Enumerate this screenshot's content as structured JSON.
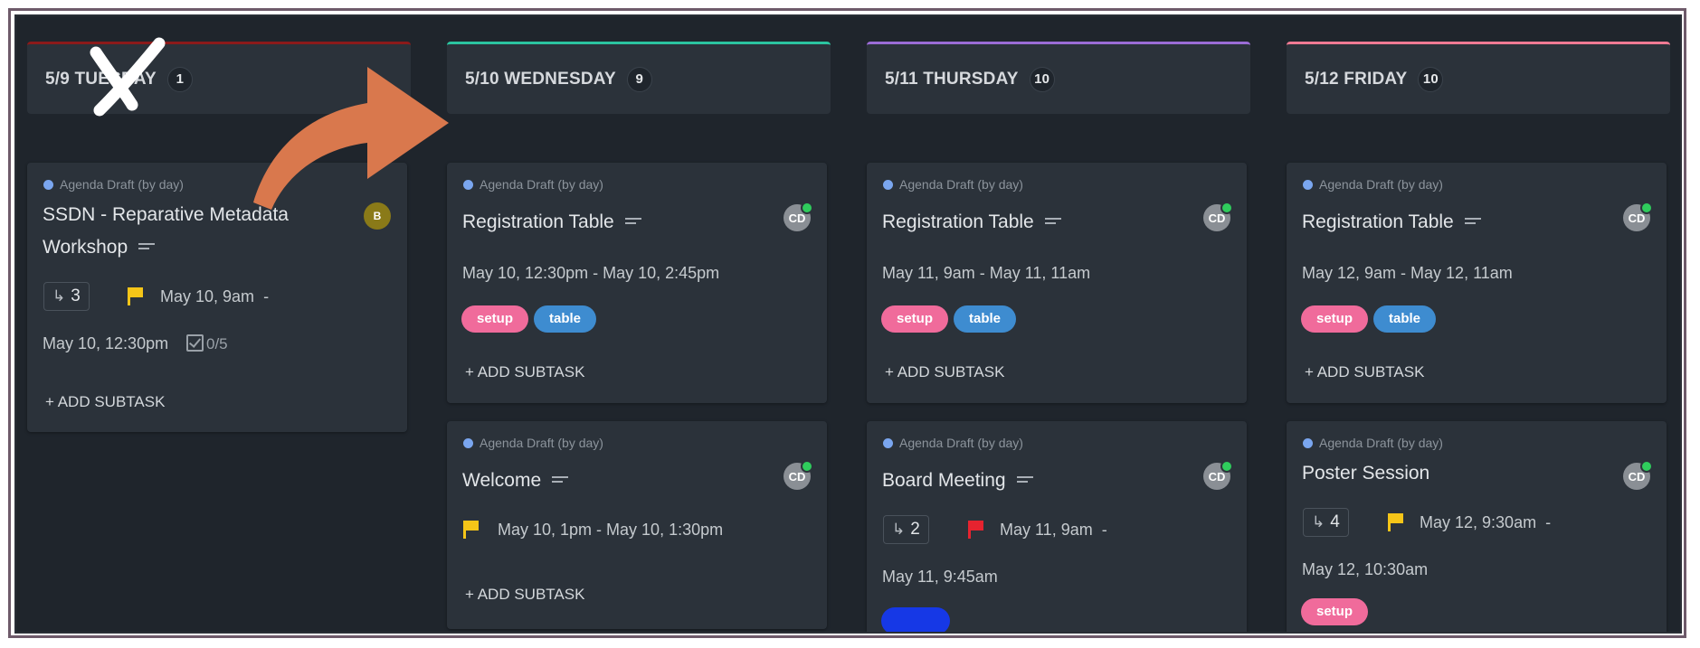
{
  "columns": [
    {
      "title": "5/9 TUESDAY",
      "count": "1",
      "accent": "#8b1a1a"
    },
    {
      "title": "5/10 WEDNESDAY",
      "count": "9",
      "accent": "#2bc4a0"
    },
    {
      "title": "5/11 THURSDAY",
      "count": "10",
      "accent": "#9b6cd6"
    },
    {
      "title": "5/12 FRIDAY",
      "count": "10",
      "accent": "#f07a93"
    }
  ],
  "list_label": "Agenda Draft (by day)",
  "add_subtask": "+ ADD SUBTASK",
  "cards": {
    "tue_1": {
      "title_l1": "SSDN - Reparative Metadata",
      "title_l2": "Workshop",
      "avatar": "B",
      "subtasks": "3",
      "start": "May 10, 9am",
      "dash": "-",
      "end": "May 10, 12:30pm",
      "checklist": "0/5"
    },
    "wed_1": {
      "title": "Registration Table",
      "avatar": "CD",
      "dates": "May 10, 12:30pm  -  May 10, 2:45pm",
      "tags": [
        "setup",
        "table"
      ]
    },
    "wed_2": {
      "title": "Welcome",
      "avatar": "CD",
      "dates": "May 10, 1pm  -  May 10, 1:30pm"
    },
    "thu_1": {
      "title": "Registration Table",
      "avatar": "CD",
      "dates": "May 11, 9am  -  May 11, 11am",
      "tags": [
        "setup",
        "table"
      ]
    },
    "thu_2": {
      "title": "Board Meeting",
      "avatar": "CD",
      "subtasks": "2",
      "start": "May 11, 9am",
      "dash": "-",
      "end": "May 11, 9:45am"
    },
    "fri_1": {
      "title": "Registration Table",
      "avatar": "CD",
      "dates": "May 12, 9am  -  May 12, 11am",
      "tags": [
        "setup",
        "table"
      ]
    },
    "fri_2": {
      "title": "Poster Session",
      "avatar": "CD",
      "subtasks": "4",
      "start": "May 12, 9:30am",
      "dash": "-",
      "end": "May 12, 10:30am",
      "tags": [
        "setup"
      ]
    }
  },
  "colors": {
    "board_bg": "#1f252c",
    "card_bg": "#2b323a",
    "arrow": "#d9784d",
    "tag_setup": "#f06b9b",
    "tag_table": "#3e8cd0"
  },
  "icons": {
    "cross_out": "x-mark-icon",
    "arrow": "curved-arrow-icon",
    "flag": "flag-icon",
    "subtask": "subtask-icon",
    "checklist": "checkbox-icon",
    "description": "description-icon"
  }
}
